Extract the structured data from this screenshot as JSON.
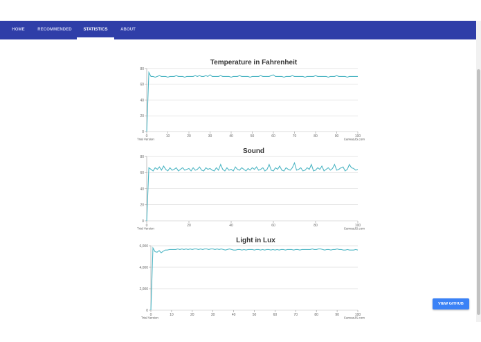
{
  "nav": {
    "items": [
      {
        "label": "HOME"
      },
      {
        "label": "RECOMMENDED"
      },
      {
        "label": "STATISTICS"
      },
      {
        "label": "ABOUT"
      }
    ],
    "active": "STATISTICS"
  },
  "footer_button": {
    "label": "VIEW GITHUB"
  },
  "colors": {
    "nav_bg": "#2f3ea8",
    "line": "#4eb6c4",
    "button": "#3b82f6"
  },
  "chart_data": [
    {
      "type": "line",
      "title": "Temperature in Fahrenheit",
      "xlim": [
        0,
        100
      ],
      "ylim": [
        0,
        80
      ],
      "x_ticks": [
        0,
        10,
        20,
        30,
        40,
        50,
        60,
        70,
        80,
        90,
        100
      ],
      "y_ticks": [
        0,
        20,
        40,
        60,
        80
      ],
      "y_tick_labels": [
        "0",
        "20",
        "40",
        "60",
        "80"
      ],
      "watermark_left": "Trial Version",
      "watermark_right": "CanvasJS.com",
      "grid": true,
      "series": [
        {
          "values": [
            0,
            75,
            70,
            70,
            69,
            70,
            71,
            70,
            70,
            70,
            69,
            70,
            70,
            70,
            71,
            70,
            70,
            70,
            69,
            70,
            70,
            70,
            70,
            71,
            70,
            71,
            70,
            70,
            71,
            70,
            72,
            70,
            70,
            70,
            70,
            71,
            70,
            70,
            70,
            70,
            69,
            70,
            70,
            70,
            71,
            70,
            70,
            70,
            70,
            69,
            70,
            70,
            70,
            70,
            71,
            70,
            70,
            70,
            70,
            71,
            72,
            70,
            70,
            70,
            70,
            69,
            70,
            70,
            70,
            71,
            70,
            70,
            70,
            70,
            70,
            69,
            70,
            70,
            70,
            70,
            71,
            70,
            70,
            70,
            70,
            70,
            69,
            70,
            70,
            70,
            71,
            70,
            70,
            70,
            70,
            69,
            70,
            70,
            70,
            70,
            70
          ]
        }
      ]
    },
    {
      "type": "line",
      "title": "Sound",
      "xlim": [
        0,
        100
      ],
      "ylim": [
        0,
        80
      ],
      "x_ticks": [
        0,
        20,
        40,
        60,
        80,
        100
      ],
      "y_ticks": [
        0,
        20,
        40,
        60,
        80
      ],
      "y_tick_labels": [
        "0",
        "20",
        "40",
        "60",
        "80"
      ],
      "watermark_left": "Trial Version",
      "watermark_right": "CanvasJS.com",
      "grid": true,
      "series": [
        {
          "values": [
            0,
            66,
            64,
            62,
            66,
            64,
            67,
            63,
            68,
            64,
            62,
            66,
            63,
            64,
            66,
            62,
            64,
            66,
            63,
            64,
            65,
            62,
            66,
            63,
            64,
            67,
            63,
            62,
            66,
            64,
            65,
            63,
            62,
            66,
            63,
            70,
            64,
            62,
            66,
            63,
            64,
            62,
            67,
            64,
            63,
            66,
            64,
            62,
            65,
            63,
            66,
            64,
            67,
            63,
            64,
            66,
            62,
            64,
            70,
            63,
            62,
            66,
            64,
            68,
            63,
            62,
            66,
            64,
            63,
            66,
            72,
            63,
            64,
            66,
            62,
            63,
            66,
            64,
            70,
            62,
            63,
            66,
            64,
            68,
            62,
            64,
            66,
            63,
            65,
            70,
            63,
            64,
            66,
            67,
            62,
            64,
            70,
            66,
            65,
            63,
            64
          ]
        }
      ]
    },
    {
      "type": "line",
      "title": "Light in Lux",
      "xlim": [
        0,
        100
      ],
      "ylim": [
        0,
        6000
      ],
      "x_ticks": [
        0,
        10,
        20,
        30,
        40,
        50,
        60,
        70,
        80,
        90,
        100
      ],
      "y_ticks": [
        0,
        2000,
        4000,
        6000
      ],
      "y_tick_labels": [
        "0",
        "2,000",
        "4,000",
        "6,000"
      ],
      "watermark_left": "Trial Version",
      "watermark_right": "CanvasJS.com",
      "grid": true,
      "series": [
        {
          "values": [
            0,
            5800,
            5450,
            5400,
            5550,
            5350,
            5500,
            5600,
            5600,
            5650,
            5650,
            5650,
            5650,
            5700,
            5650,
            5700,
            5650,
            5700,
            5650,
            5700,
            5650,
            5700,
            5700,
            5650,
            5700,
            5650,
            5700,
            5700,
            5650,
            5700,
            5700,
            5650,
            5700,
            5650,
            5700,
            5650,
            5600,
            5650,
            5700,
            5650,
            5600,
            5600,
            5650,
            5650,
            5600,
            5650,
            5600,
            5650,
            5650,
            5650,
            5600,
            5650,
            5650,
            5600,
            5650,
            5600,
            5650,
            5650,
            5600,
            5650,
            5600,
            5650,
            5600,
            5650,
            5650,
            5600,
            5650,
            5650,
            5650,
            5600,
            5650,
            5650,
            5600,
            5650,
            5650,
            5650,
            5650,
            5650,
            5700,
            5650,
            5650,
            5700,
            5700,
            5650,
            5600,
            5650,
            5650,
            5600,
            5650,
            5650,
            5700,
            5650,
            5650,
            5600,
            5600,
            5650,
            5600,
            5600,
            5600,
            5650,
            5600
          ]
        }
      ]
    }
  ]
}
